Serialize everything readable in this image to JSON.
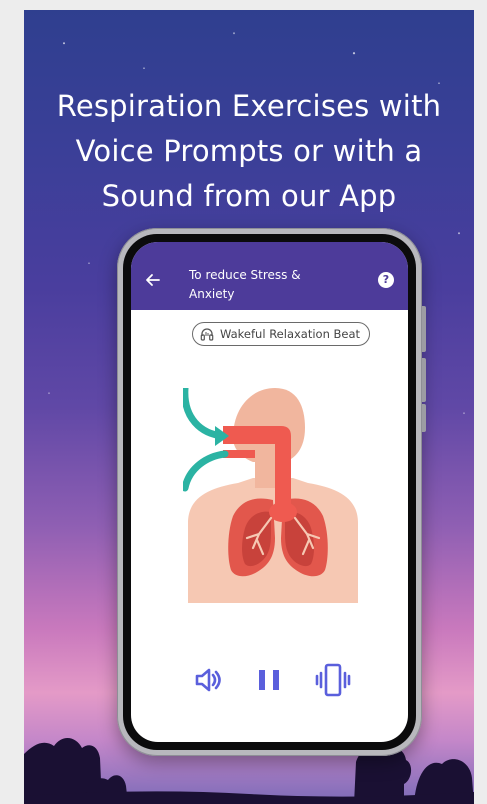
{
  "promo": {
    "headline_lines": [
      "Respiration Exercises with",
      "Voice Prompts or with a",
      "Sound from our App"
    ]
  },
  "app": {
    "title_line1": "To reduce Stress &",
    "title_line2": "Anxiety",
    "help_symbol": "?",
    "beat_chip_label": "Wakeful Relaxation Beat",
    "accent_color": "#4d3b9a",
    "control_color": "#5a5fdc"
  },
  "icons": {
    "back": "arrow-left-icon",
    "help": "help-circle-icon",
    "beat": "headphones-icon",
    "sound": "volume-icon",
    "pause": "pause-icon",
    "vibrate": "vibrate-icon"
  }
}
